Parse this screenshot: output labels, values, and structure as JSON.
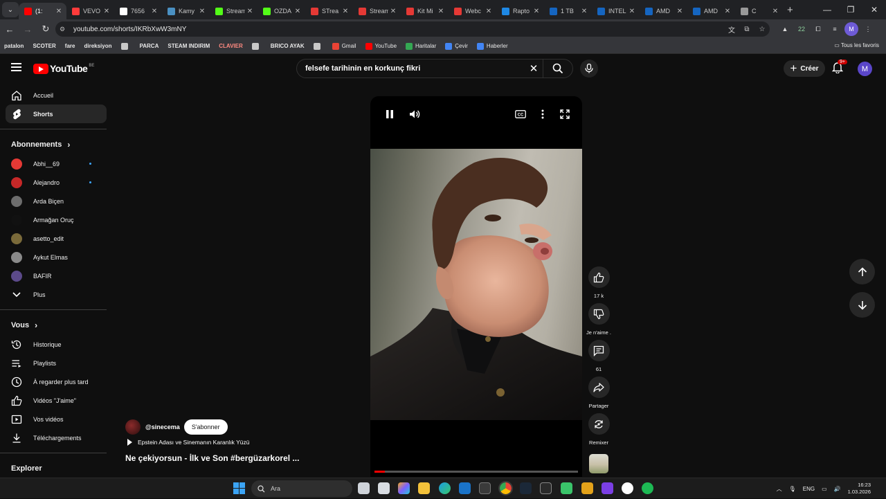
{
  "browser": {
    "tabs": [
      {
        "title": "(1:",
        "favicon_color": "#ff0000",
        "active": true
      },
      {
        "title": "VEVO",
        "favicon_color": "#ff3b3b"
      },
      {
        "title": "7656",
        "favicon_color": "#ffffff"
      },
      {
        "title": "Kamy",
        "favicon_color": "#4a90c2"
      },
      {
        "title": "Stream",
        "favicon_color": "#53fc18"
      },
      {
        "title": "OZDA",
        "favicon_color": "#53fc18"
      },
      {
        "title": "STrea",
        "favicon_color": "#e53935"
      },
      {
        "title": "Stream",
        "favicon_color": "#e53935"
      },
      {
        "title": "Kit Mi",
        "favicon_color": "#e53935"
      },
      {
        "title": "Webc",
        "favicon_color": "#e53935"
      },
      {
        "title": "Rapto",
        "favicon_color": "#1e88e5"
      },
      {
        "title": "1 TB",
        "favicon_color": "#1565c0"
      },
      {
        "title": "INTEL",
        "favicon_color": "#1565c0"
      },
      {
        "title": "AMD",
        "favicon_color": "#1565c0"
      },
      {
        "title": "AMD",
        "favicon_color": "#1565c0"
      },
      {
        "title": "C",
        "favicon_color": "#999999"
      }
    ],
    "url": "youtube.com/shorts/IKRbXwW3mNY",
    "profile_letter": "M",
    "extension_badge": "22",
    "bookmarks": [
      {
        "label": "patalon",
        "bold": true
      },
      {
        "label": "SCOTER",
        "bold": true
      },
      {
        "label": "fare",
        "bold": true
      },
      {
        "label": "direksiyon",
        "bold": true
      },
      {
        "label": "",
        "icon": true
      },
      {
        "label": "PARCA",
        "bold": true
      },
      {
        "label": "STEAM INDIRIM",
        "bold": true
      },
      {
        "label": "CLAVIER",
        "bold": true,
        "color": "#ff8a80"
      },
      {
        "label": "",
        "icon": true
      },
      {
        "label": "BRICO AYAK",
        "bold": true
      },
      {
        "label": "",
        "icon": "grid"
      },
      {
        "label": "Gmail",
        "icon_color": "#ea4335"
      },
      {
        "label": "YouTube",
        "icon_color": "#ff0000"
      },
      {
        "label": "Haritalar",
        "icon_color": "#34a853"
      },
      {
        "label": "Çevir",
        "icon_color": "#4285f4"
      },
      {
        "label": "Haberler",
        "icon_color": "#4285f4"
      }
    ],
    "all_bookmarks": "Tous les favoris"
  },
  "youtube": {
    "logo_word": "YouTube",
    "country_code": "BE",
    "search_query": "felsefe tarihinin en korkunç fikri",
    "create_label": "Créer",
    "notif_badge": "9+",
    "avatar_letter": "M"
  },
  "sidebar": {
    "main": [
      {
        "label": "Accueil",
        "icon": "home-icon"
      },
      {
        "label": "Shorts",
        "icon": "shorts-icon",
        "selected": true
      }
    ],
    "subs_title": "Abonnements",
    "subs": [
      {
        "label": "Abhi__69",
        "color": "#e53935",
        "dot": true
      },
      {
        "label": "Alejandro",
        "color": "#c62828",
        "dot": true
      },
      {
        "label": "Arda Biçen",
        "color": "#6d6d6d"
      },
      {
        "label": "Armağan Oruç",
        "color": "#111111"
      },
      {
        "label": "asetto_edit",
        "color": "#7a6a3a"
      },
      {
        "label": "Aykut Elmas",
        "color": "#8a8a8a"
      },
      {
        "label": "BAFIR",
        "color": "#5c4a8a"
      }
    ],
    "subs_more": "Plus",
    "you_title": "Vous",
    "you": [
      {
        "label": "Historique",
        "icon": "history-icon"
      },
      {
        "label": "Playlists",
        "icon": "playlists-icon"
      },
      {
        "label": "À regarder plus tard",
        "icon": "watch-later-icon"
      },
      {
        "label": "Vidéos \"J'aime\"",
        "icon": "liked-icon"
      },
      {
        "label": "Vos vidéos",
        "icon": "your-videos-icon"
      },
      {
        "label": "Téléchargements",
        "icon": "downloads-icon"
      }
    ],
    "explore_title": "Explorer"
  },
  "short": {
    "likes": "17 k",
    "dislike_label": "Je n'aime .",
    "comments": "61",
    "share_label": "Partager",
    "remix_label": "Remixer",
    "channel": "@sinecema",
    "subscribe_label": "S'abonner",
    "playlist_line": "Epstein Adası ve Sinemanın Karanlık Yüzü",
    "title": "Ne çekiyorsun - İlk ve Son #bergüzarkorel ...",
    "progress": 0.05
  },
  "taskbar": {
    "search_placeholder": "Ara",
    "lang": "ENG",
    "time": "16:23",
    "date": "1.03.2026"
  }
}
